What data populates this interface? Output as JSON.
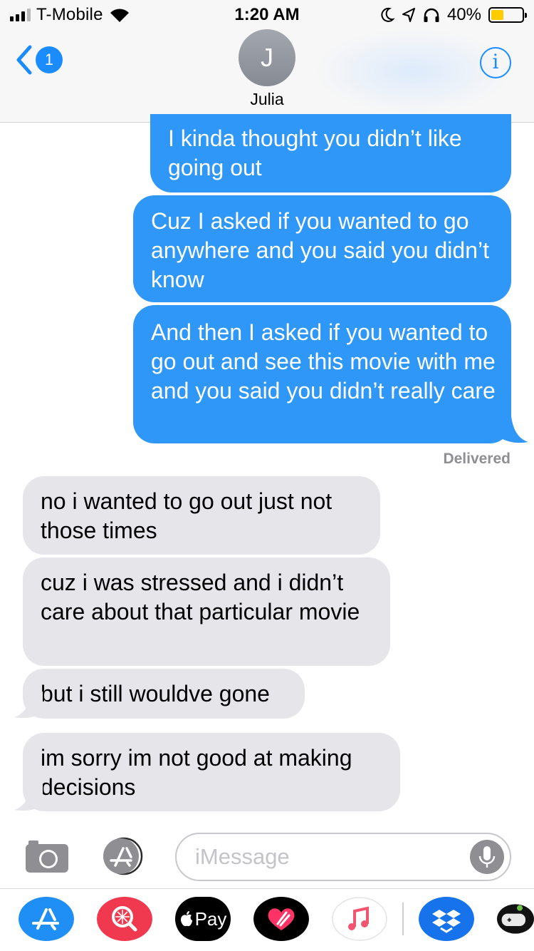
{
  "status_bar": {
    "carrier": "T-Mobile",
    "time": "1:20 AM",
    "battery_percent": "40%",
    "battery_level": 0.4,
    "battery_color": "#ffcc00",
    "icons": [
      "signal-icon",
      "wifi-icon",
      "moon-icon",
      "location-arrow-icon",
      "headphones-icon",
      "battery-icon"
    ]
  },
  "header": {
    "back_count": "1",
    "avatar_initial": "J",
    "contact_name": "Julia",
    "info_glyph": "i"
  },
  "messages": [
    {
      "direction": "sent",
      "text": "I kinda thought you didn’t like going out"
    },
    {
      "direction": "sent",
      "text": "Cuz I asked if you wanted to go anywhere and you said you didn’t know"
    },
    {
      "direction": "sent",
      "text": "And then I asked if you wanted to go out and see this movie with me and you said you didn’t really care"
    },
    {
      "direction": "received",
      "text": "no i wanted to go out just not those times"
    },
    {
      "direction": "received",
      "text": "cuz i was stressed and i didn’t care about that particular movie"
    },
    {
      "direction": "received",
      "text": "but i still wouldve gone"
    },
    {
      "direction": "received",
      "text": "im sorry im not good at making decisions"
    }
  ],
  "delivered_label": "Delivered",
  "composer": {
    "placeholder": "iMessage"
  },
  "app_drawer": {
    "apple_pay_label": "Pay",
    "apps": [
      "app-store-icon",
      "search-images-icon",
      "apple-pay-icon",
      "digital-touch-icon",
      "music-icon",
      "dropbox-icon",
      "game-icon"
    ]
  },
  "colors": {
    "sent_bubble": "#2f97f8",
    "received_bubble": "#e6e5ea",
    "accent": "#1a8cff"
  }
}
